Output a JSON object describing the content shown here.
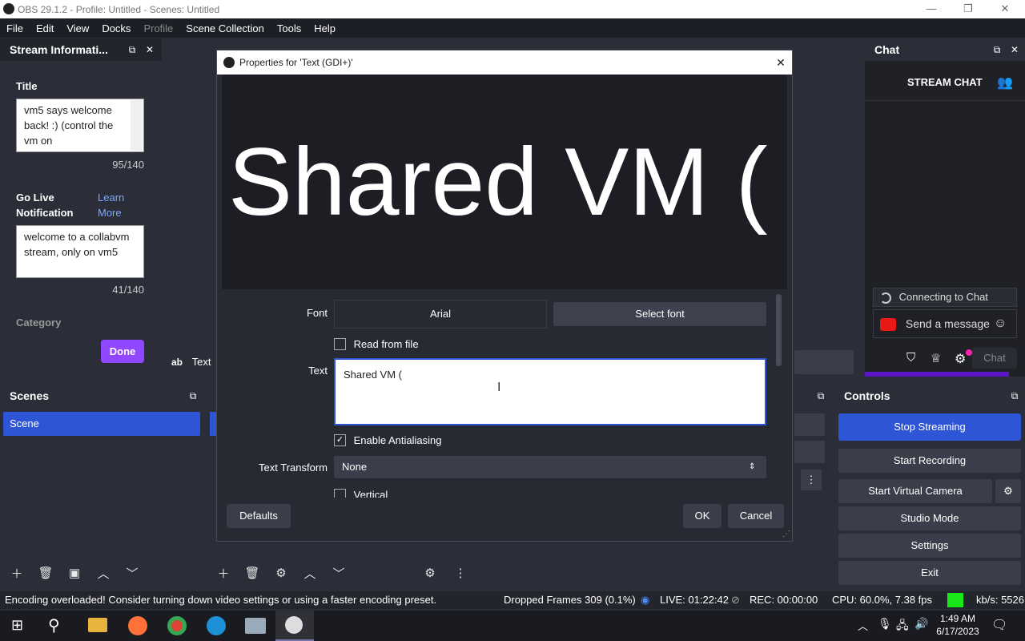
{
  "window": {
    "title": "OBS 29.1.2 - Profile: Untitled - Scenes: Untitled",
    "minimize": "—",
    "maximize": "❐",
    "close": "✕"
  },
  "menu": [
    "File",
    "Edit",
    "View",
    "Docks",
    "Profile",
    "Scene Collection",
    "Tools",
    "Help"
  ],
  "stream_info": {
    "title": "Stream Informati...",
    "title_label": "Title",
    "title_value": "vm5 says welcome back! :) (control the vm on",
    "title_count": "95/140",
    "golive_label": "Go Live Notification",
    "learn_more": "Learn More",
    "notification_value": "welcome to a collabvm stream, only on vm5",
    "notification_count": "41/140",
    "category_label": "Category",
    "done": "Done"
  },
  "source_row": {
    "icon": "ab",
    "label": "Text"
  },
  "dialog": {
    "title": "Properties for 'Text (GDI+)'",
    "close": "✕",
    "preview_text": "Shared VM (",
    "font_label": "Font",
    "font_value": "Arial",
    "select_font": "Select font",
    "read_from_file": "Read from file",
    "text_label": "Text",
    "text_value": "Shared VM (",
    "enable_antialiasing": "Enable Antialiasing",
    "text_transform_label": "Text Transform",
    "text_transform_value": "None",
    "vertical": "Vertical",
    "defaults": "Defaults",
    "ok": "OK",
    "cancel": "Cancel"
  },
  "chat": {
    "title": "Chat",
    "stream_chat": "STREAM CHAT",
    "connecting": "Connecting to Chat",
    "send_message": "Send a message",
    "chat_button": "Chat"
  },
  "scenes": {
    "title": "Scenes",
    "items": [
      "Scene"
    ]
  },
  "controls": {
    "title": "Controls",
    "stop_streaming": "Stop Streaming",
    "start_recording": "Start Recording",
    "start_virtual_camera": "Start Virtual Camera",
    "studio_mode": "Studio Mode",
    "settings": "Settings",
    "exit": "Exit"
  },
  "status": {
    "message": "Encoding overloaded! Consider turning down video settings or using a faster encoding preset.",
    "dropped": "Dropped Frames 309 (0.1%)",
    "live": "LIVE: 01:22:42",
    "rec": "REC: 00:00:00",
    "cpu": "CPU: 60.0%, 7.38 fps",
    "kbs": "kb/s: 5526"
  },
  "taskbar": {
    "time": "1:49 AM",
    "date": "6/17/2023"
  },
  "colors": {
    "accent": "#2d55d6",
    "purple": "#9147ff",
    "green": "#19e619"
  }
}
